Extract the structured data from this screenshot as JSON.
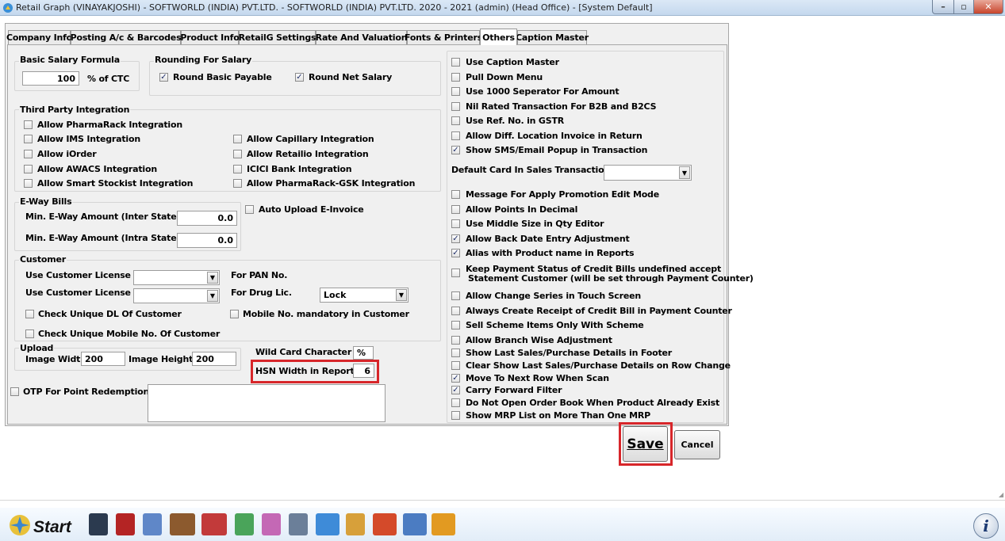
{
  "window": {
    "title": "Retail Graph (VINAYAKJOSHI) - SOFTWORLD (INDIA) PVT.LTD. - SOFTWORLD (INDIA) PVT.LTD.  2020 - 2021 (admin) (Head Office)  - [System Default]"
  },
  "tabs": [
    "Company Info",
    "Posting A/c & Barcodes",
    "Product Info",
    "RetailG Settings",
    "Rate And Valuation",
    "Fonts & Printers",
    "Others",
    "Caption Master"
  ],
  "selected_tab": "Others",
  "basic_salary": {
    "legend": "Basic Salary Formula",
    "value": "100",
    "suffix": "% of CTC"
  },
  "rounding": {
    "legend": "Rounding For Salary",
    "basic": "Round Basic Payable",
    "net": "Round Net Salary"
  },
  "third_party": {
    "legend": "Third Party Integration",
    "items": [
      "Allow PharmaRack Integration",
      "Allow IMS Integration",
      "Allow iOrder",
      "Allow AWACS Integration",
      "Allow Smart Stockist Integration",
      "Allow Capillary Integration",
      "Allow Retailio Integration",
      "ICICI Bank Integration",
      "Allow PharmaRack-GSK Integration"
    ]
  },
  "eway": {
    "legend": "E-Way Bills",
    "inter_label": "Min. E-Way Amount (Inter State)",
    "inter_value": "0.0",
    "intra_label": "Min. E-Way Amount (Intra State)",
    "intra_value": "0.0",
    "auto_upload": "Auto Upload E-Invoice"
  },
  "customer": {
    "legend": "Customer",
    "license1": "Use Customer License",
    "pan": "For PAN No.",
    "license2": "Use Customer License",
    "drug": "For Drug Lic.",
    "drug_value": "Lock",
    "unique_dl": "Check Unique DL Of Customer",
    "mobile_mandatory": "Mobile No. mandatory in Customer",
    "unique_mobile": "Check Unique Mobile No. Of Customer"
  },
  "upload": {
    "legend": "Upload",
    "width_label": "Image Width",
    "width_value": "200",
    "height_label": "Image Height",
    "height_value": "200"
  },
  "wildcard": {
    "label": "Wild Card Character",
    "value": "%"
  },
  "hsn": {
    "label": "HSN Width in Report",
    "value": "6"
  },
  "otp": {
    "label": "OTP For Point Redemption"
  },
  "right_top": [
    {
      "label": "Use Caption Master",
      "checked": false
    },
    {
      "label": "Pull Down Menu",
      "checked": false
    },
    {
      "label": "Use 1000 Seperator For Amount",
      "checked": false
    },
    {
      "label": "Nil Rated Transaction For B2B and B2CS",
      "checked": false
    },
    {
      "label": "Use Ref. No. in GSTR",
      "checked": false
    },
    {
      "label": "Allow Diff. Location Invoice in Return",
      "checked": false
    },
    {
      "label": "Show SMS/Email Popup in Transaction",
      "checked": true
    }
  ],
  "default_card": {
    "label": "Default Card In Sales Transaction",
    "value": ""
  },
  "right_mid": [
    {
      "label": "Message For Apply Promotion Edit Mode",
      "checked": false
    },
    {
      "label": "Allow Points In Decimal",
      "checked": false
    },
    {
      "label": "Use Middle Size in Qty Editor",
      "checked": false
    },
    {
      "label": "Allow Back Date Entry Adjustment",
      "checked": true
    },
    {
      "label": "Alias with Product name in Reports",
      "checked": true
    }
  ],
  "keep_payment": {
    "line1": "Keep Payment Status of Credit Bills undefined accept",
    "line2": "Statement Customer (will be set through Payment Counter)"
  },
  "right_bottom": [
    {
      "label": "Allow Change Series in Touch Screen",
      "checked": false
    },
    {
      "label": "Always Create Receipt of Credit Bill in Payment Counter",
      "checked": false
    },
    {
      "label": "Sell Scheme Items Only With Scheme",
      "checked": false
    },
    {
      "label": "Allow Branch Wise Adjustment",
      "checked": false
    },
    {
      "label": "Show Last Sales/Purchase Details in Footer",
      "checked": false
    },
    {
      "label": "Clear Show Last Sales/Purchase Details on Row Change",
      "checked": false
    },
    {
      "label": "Move To Next Row When Scan",
      "checked": true
    },
    {
      "label": "Carry Forward Filter",
      "checked": true
    },
    {
      "label": "Do Not Open Order Book When Product Already Exist",
      "checked": false
    },
    {
      "label": "Show MRP List on More Than One MRP",
      "checked": false
    }
  ],
  "buttons": {
    "save": "Save",
    "cancel": "Cancel"
  },
  "taskbar": {
    "start": "Start",
    "info": "i"
  },
  "colors": {
    "highlight": "#d7262a",
    "check": "#21306b"
  }
}
